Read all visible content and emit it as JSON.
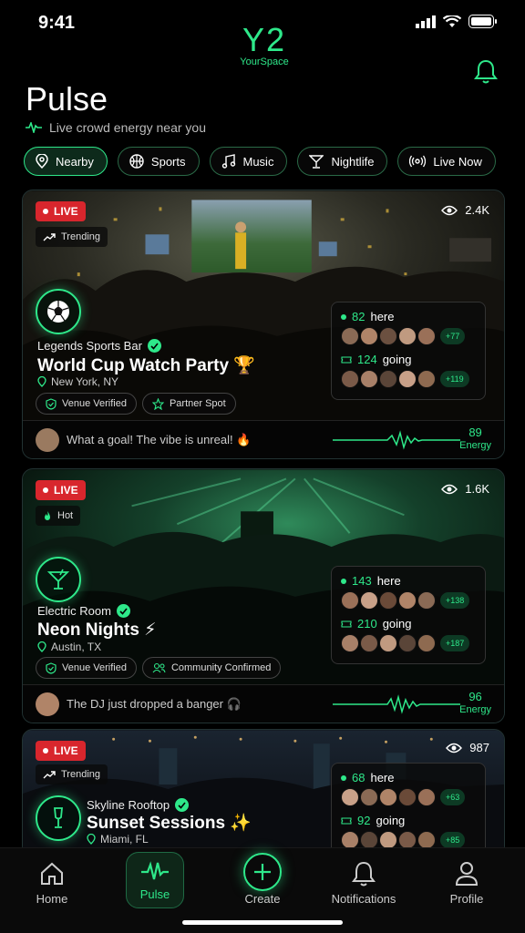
{
  "status": {
    "time": "9:41"
  },
  "brand": {
    "mark": "Y2",
    "name": "YourSpace"
  },
  "page": {
    "title": "Pulse",
    "subtitle": "Live crowd energy near you"
  },
  "chips": [
    {
      "label": "Nearby",
      "icon": "location-pin-icon",
      "active": true
    },
    {
      "label": "Sports",
      "icon": "basketball-icon",
      "active": false
    },
    {
      "label": "Music",
      "icon": "music-note-icon",
      "active": false
    },
    {
      "label": "Nightlife",
      "icon": "cocktail-icon",
      "active": false
    },
    {
      "label": "Live Now",
      "icon": "broadcast-icon",
      "active": false
    }
  ],
  "cards": [
    {
      "live": "LIVE",
      "tag": "Trending",
      "views": "2.4K",
      "venue": "Legends Sports Bar",
      "title": "World Cup Watch Party 🏆",
      "location": "New York, NY",
      "badges": [
        "Venue Verified",
        "Partner Spot"
      ],
      "here": "82",
      "here_label": "here",
      "here_more": "+77",
      "going": "124",
      "going_label": "going",
      "going_more": "+119",
      "comment": "What a goal! The vibe is unreal! 🔥",
      "energy": "89",
      "energy_label": "Energy"
    },
    {
      "live": "LIVE",
      "tag": "Hot",
      "views": "1.6K",
      "venue": "Electric Room",
      "title": "Neon Nights ⚡",
      "location": "Austin, TX",
      "badges": [
        "Venue Verified",
        "Community Confirmed"
      ],
      "here": "143",
      "here_label": "here",
      "here_more": "+138",
      "going": "210",
      "going_label": "going",
      "going_more": "+187",
      "comment": "The DJ just dropped a banger 🎧",
      "energy": "96",
      "energy_label": "Energy"
    },
    {
      "live": "LIVE",
      "tag": "Trending",
      "views": "987",
      "venue": "Skyline Rooftop",
      "title": "Sunset Sessions ✨",
      "location": "Miami, FL",
      "here": "68",
      "here_label": "here",
      "here_more": "+63",
      "going": "92",
      "going_label": "going",
      "going_more": "+85"
    }
  ],
  "nav": [
    {
      "label": "Home",
      "icon": "home-icon"
    },
    {
      "label": "Pulse",
      "icon": "pulse-icon",
      "active": true
    },
    {
      "label": "Create",
      "icon": "plus-icon"
    },
    {
      "label": "Notifications",
      "icon": "bell-icon"
    },
    {
      "label": "Profile",
      "icon": "person-icon"
    }
  ],
  "colors": {
    "accent": "#2ee88a",
    "live": "#d8262d",
    "background": "#000000"
  }
}
